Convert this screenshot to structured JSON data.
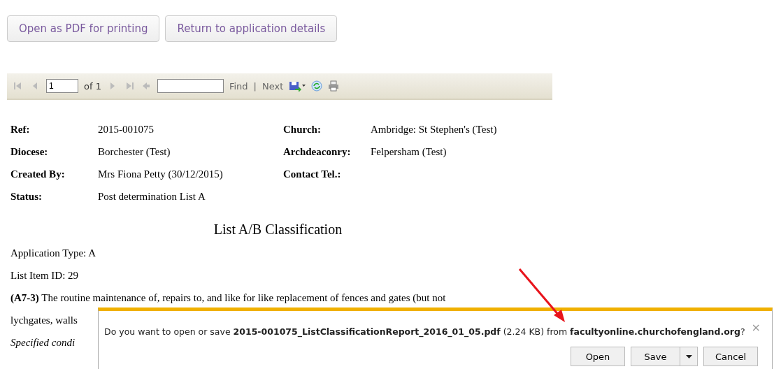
{
  "buttons": [
    "Open as PDF for printing",
    "Return to application details"
  ],
  "toolbar": {
    "page": "1",
    "page_count": "of 1",
    "find_label": "Find",
    "separator": "|",
    "next_label": "Next"
  },
  "details": [
    {
      "label": "Ref:",
      "value": "2015-001075",
      "label_2": "Church:",
      "value_2": "Ambridge: St Stephen's (Test)"
    },
    {
      "label": "Diocese:",
      "value": "Borchester (Test)",
      "label_2": "Archdeaconry:",
      "value_2": "Felpersham (Test)"
    },
    {
      "label": "Created By:",
      "value": "Mrs Fiona Petty (30/12/2015)",
      "label_2": "Contact Tel.:"
    },
    {
      "label": "Status:",
      "value": "Post determination List A"
    }
  ],
  "heading": "List A/B Classification",
  "paragraphs": [
    {
      "kind": "plain",
      "text": "Application Type: A"
    },
    {
      "kind": "plain",
      "text": "List Item ID: 29"
    },
    {
      "kind": "plain",
      "text": "**(A7-3)** The routine maintenance of, repairs to, and like for like replacement of fences and gates (but not"
    },
    {
      "kind": "plain",
      "text": "lychgates, walls"
    },
    {
      "kind": "italic",
      "text": "Specified condi"
    }
  ],
  "dialog": {
    "message": "Do you want to open or save **2015-001075_ListClassificationReport_2016_01_05.pdf** (2.24 KB) from **facultyonline.churchofengland.org**?",
    "close": "×",
    "buttons": [
      {
        "label": "Open",
        "kind": "plain"
      },
      {
        "label": "Save",
        "kind": "split"
      },
      {
        "label": "Cancel",
        "kind": "plain"
      }
    ]
  }
}
